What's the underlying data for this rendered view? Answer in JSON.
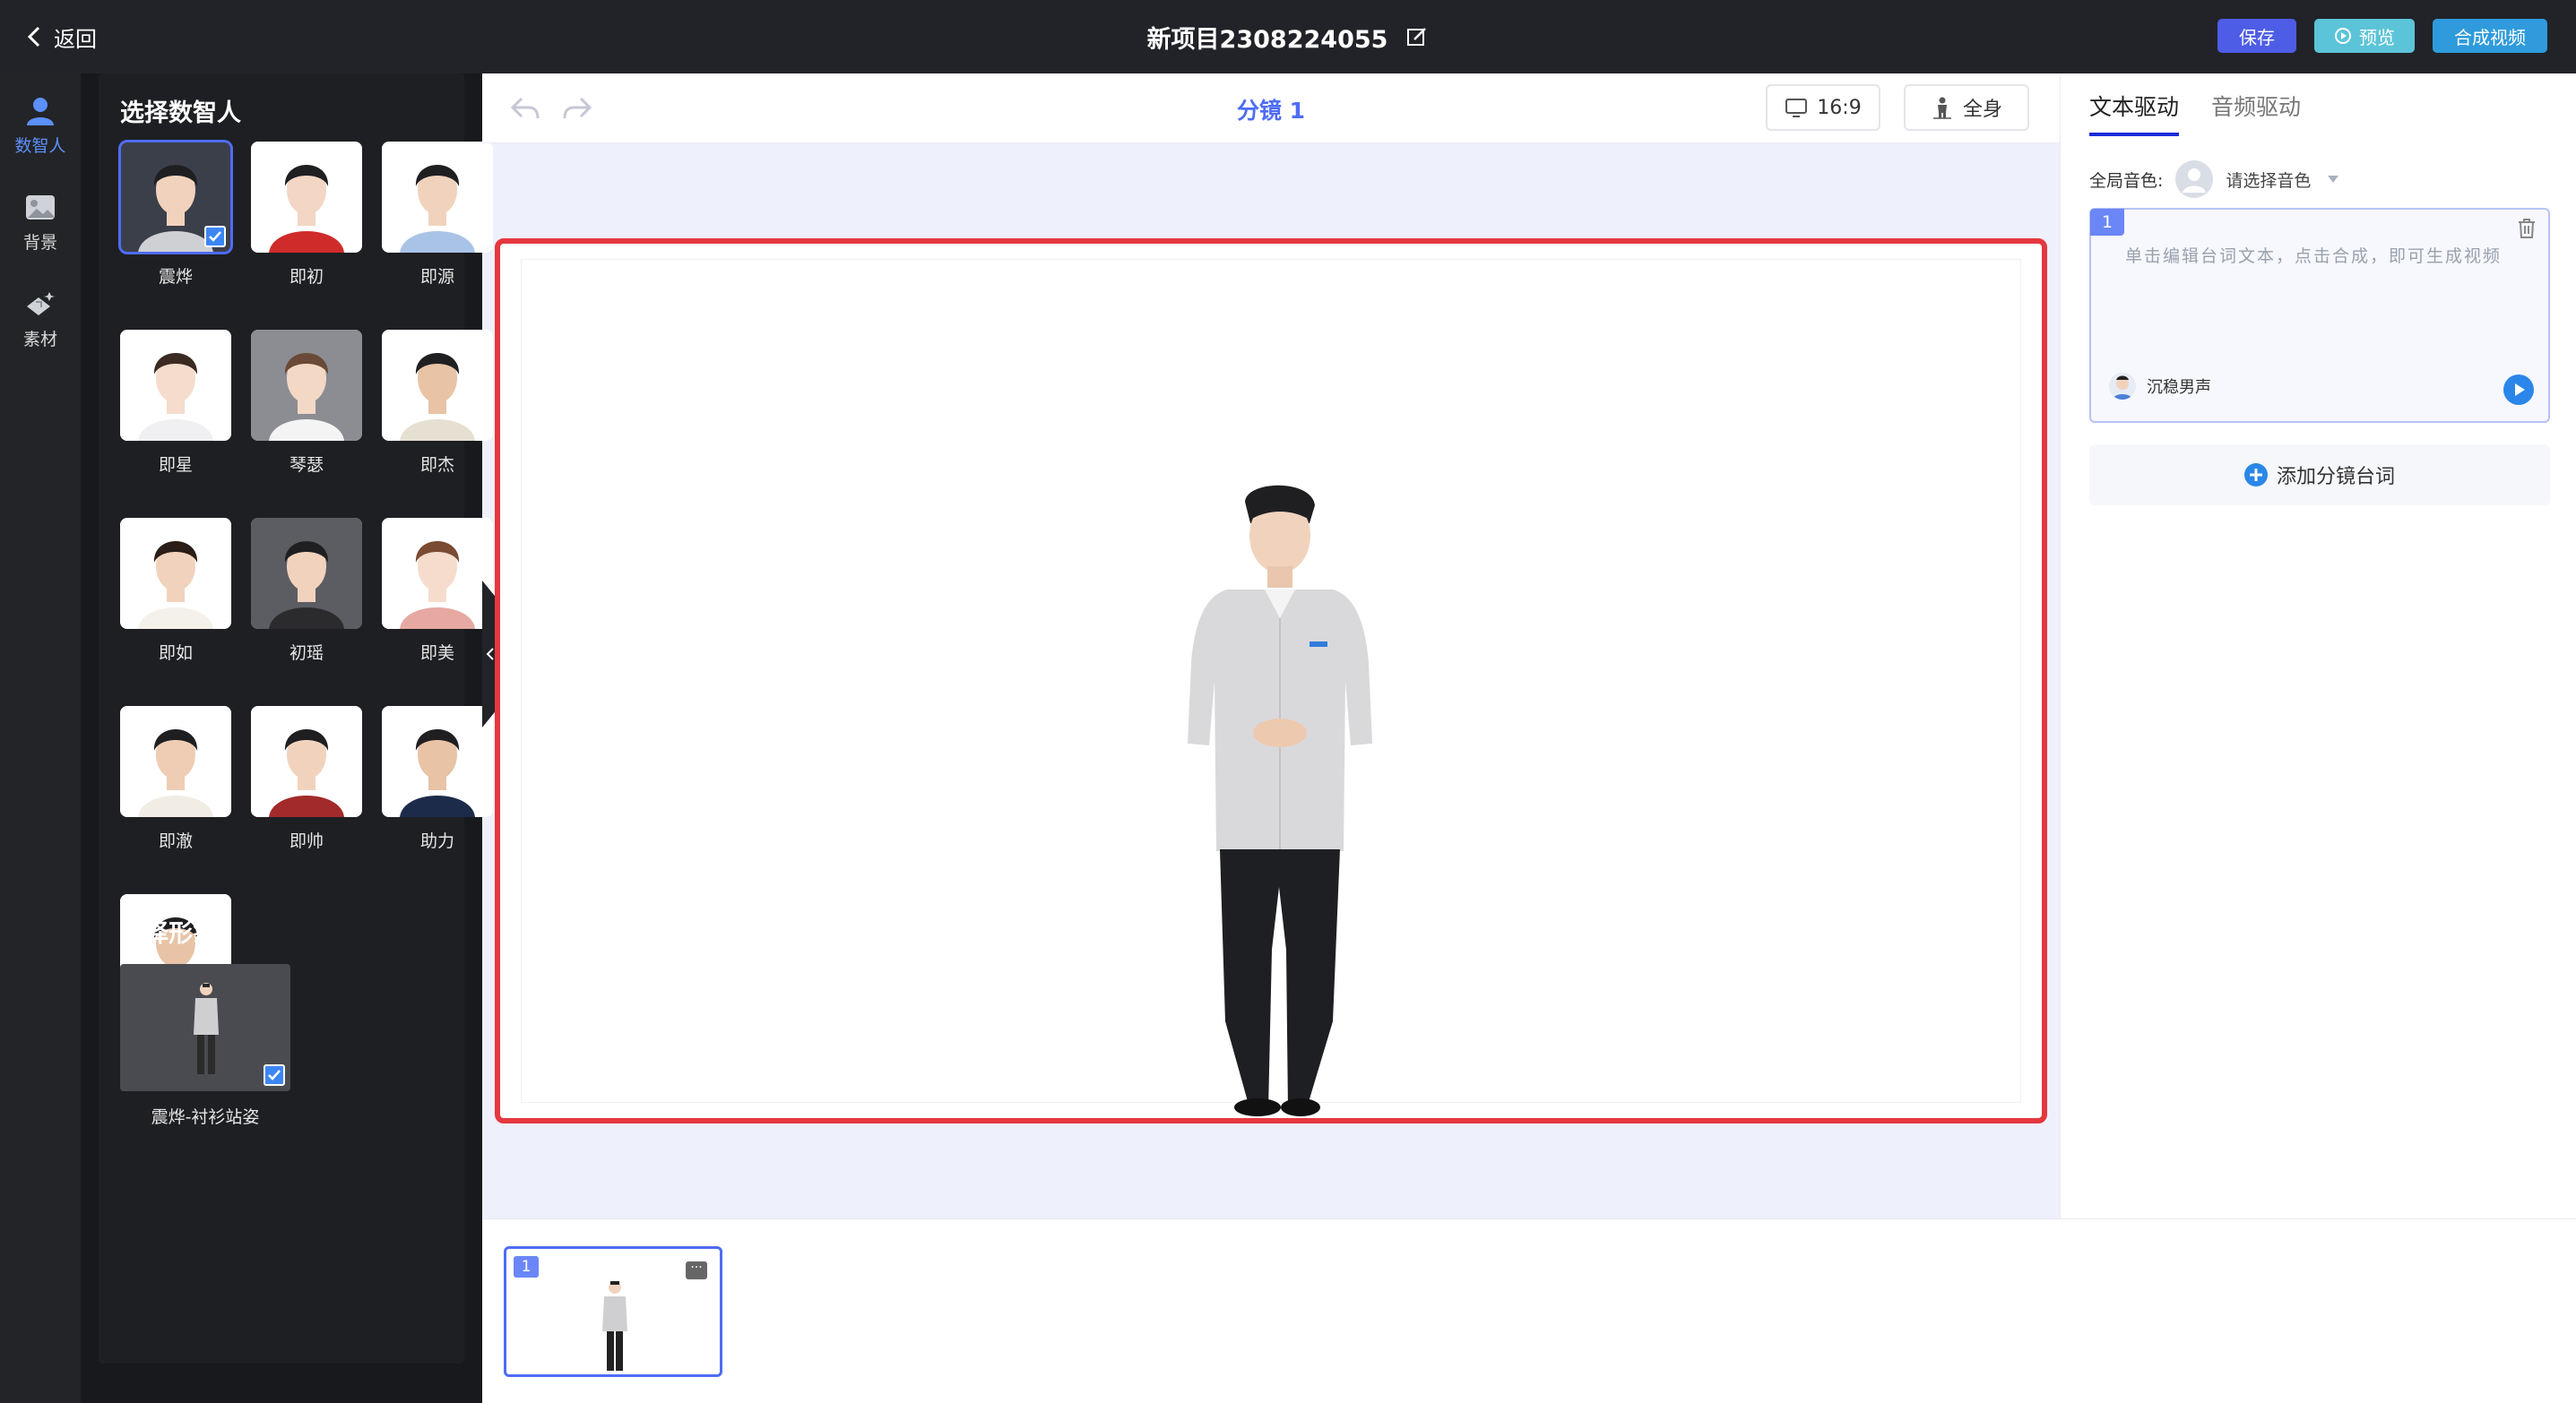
{
  "topbar": {
    "back_label": "返回",
    "project_title": "新项目2308224055",
    "save_label": "保存",
    "preview_label": "预览",
    "compose_label": "合成视频"
  },
  "sidebar": {
    "items": [
      {
        "label": "数智人",
        "icon": "digital-human-icon",
        "active": true
      },
      {
        "label": "背景",
        "icon": "background-icon",
        "active": false
      },
      {
        "label": "素材",
        "icon": "material-icon",
        "active": false
      }
    ]
  },
  "avatar_panel": {
    "title": "选择数智人",
    "avatars": [
      {
        "name": "震烨",
        "selected": true
      },
      {
        "name": "即初"
      },
      {
        "name": "即源"
      },
      {
        "name": "即星"
      },
      {
        "name": "琴瑟"
      },
      {
        "name": "即杰"
      },
      {
        "name": "即如"
      },
      {
        "name": "初瑶"
      },
      {
        "name": "即美"
      },
      {
        "name": "即澈"
      },
      {
        "name": "即帅"
      },
      {
        "name": "助力"
      },
      {
        "name": ""
      }
    ],
    "image_title": "选择形象",
    "images": [
      {
        "name": "震烨-衬衫站姿",
        "selected": true
      }
    ]
  },
  "canvas": {
    "scene_title": "分镜 1",
    "ratio_label": "16:9",
    "body_label": "全身"
  },
  "scene_strip": {
    "scenes": [
      {
        "index": "1",
        "more": "···"
      }
    ]
  },
  "right_panel": {
    "tab_text": "文本驱动",
    "tab_audio": "音频驱动",
    "global_voice_label": "全局音色:",
    "voice_placeholder": "请选择音色",
    "script": {
      "index": "1",
      "placeholder": "单击编辑台词文本，点击合成，即可生成视频",
      "voice_name": "沉稳男声"
    },
    "add_line_label": "添加分镜台词"
  },
  "colors": {
    "accent": "#4e6cf5",
    "stage_border": "#e5383f",
    "topbar_bg": "#222328"
  }
}
